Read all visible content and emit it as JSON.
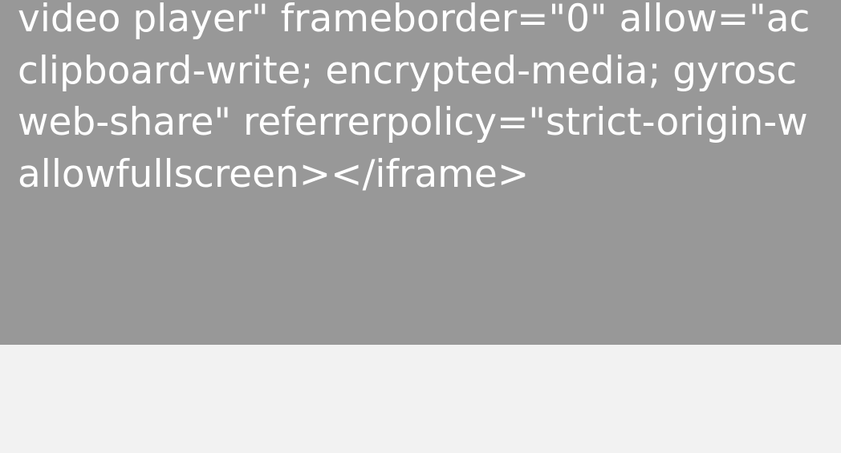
{
  "embed": {
    "lines": [
      "video player\" frameborder=\"0\" allow=\"ac",
      "clipboard-write; encrypted-media; gyrosc",
      "web-share\" referrerpolicy=\"strict-origin-w",
      "allowfullscreen></iframe>"
    ]
  },
  "colors": {
    "placeholder_bg": "#989898",
    "page_bg": "#f2f2f2",
    "text": "#ffffff"
  }
}
